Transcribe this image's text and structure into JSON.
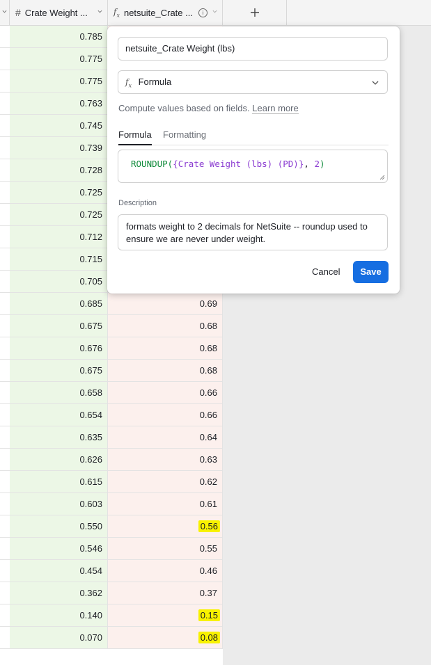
{
  "header": {
    "column1": {
      "label": "Crate Weight ...",
      "icon": "hash-icon"
    },
    "column2": {
      "label": "netsuite_Crate ...",
      "icon": "formula-icon"
    },
    "add_symbol": "+"
  },
  "rows": [
    {
      "crate_weight": "0.785",
      "netsuite": ""
    },
    {
      "crate_weight": "0.775",
      "netsuite": ""
    },
    {
      "crate_weight": "0.775",
      "netsuite": ""
    },
    {
      "crate_weight": "0.763",
      "netsuite": ""
    },
    {
      "crate_weight": "0.745",
      "netsuite": ""
    },
    {
      "crate_weight": "0.739",
      "netsuite": ""
    },
    {
      "crate_weight": "0.728",
      "netsuite": ""
    },
    {
      "crate_weight": "0.725",
      "netsuite": ""
    },
    {
      "crate_weight": "0.725",
      "netsuite": ""
    },
    {
      "crate_weight": "0.712",
      "netsuite": ""
    },
    {
      "crate_weight": "0.715",
      "netsuite": ""
    },
    {
      "crate_weight": "0.705",
      "netsuite": ""
    },
    {
      "crate_weight": "0.685",
      "netsuite": "0.69"
    },
    {
      "crate_weight": "0.675",
      "netsuite": "0.68"
    },
    {
      "crate_weight": "0.676",
      "netsuite": "0.68"
    },
    {
      "crate_weight": "0.675",
      "netsuite": "0.68"
    },
    {
      "crate_weight": "0.658",
      "netsuite": "0.66"
    },
    {
      "crate_weight": "0.654",
      "netsuite": "0.66"
    },
    {
      "crate_weight": "0.635",
      "netsuite": "0.64"
    },
    {
      "crate_weight": "0.626",
      "netsuite": "0.63"
    },
    {
      "crate_weight": "0.615",
      "netsuite": "0.62"
    },
    {
      "crate_weight": "0.603",
      "netsuite": "0.61"
    },
    {
      "crate_weight": "0.550",
      "netsuite": "0.56",
      "highlighted": true
    },
    {
      "crate_weight": "0.546",
      "netsuite": "0.55"
    },
    {
      "crate_weight": "0.454",
      "netsuite": "0.46"
    },
    {
      "crate_weight": "0.362",
      "netsuite": "0.37"
    },
    {
      "crate_weight": "0.140",
      "netsuite": "0.15",
      "highlighted": true
    },
    {
      "crate_weight": "0.070",
      "netsuite": "0.08",
      "highlighted": true
    }
  ],
  "field_editor": {
    "name_value": "netsuite_Crate Weight (lbs)",
    "type_label": "Formula",
    "helper_text": "Compute values based on fields.",
    "learn_more": "Learn more",
    "tabs": [
      "Formula",
      "Formatting"
    ],
    "formula": {
      "fn": "ROUNDUP(",
      "ref": "{Crate Weight (lbs) (PD)}",
      "sep": ", ",
      "num": "2",
      "close": ")"
    },
    "description_label": "Description",
    "description_value": "formats weight to 2 decimals for NetSuite -- roundup used to ensure we are never under weight.",
    "cancel_label": "Cancel",
    "save_label": "Save"
  },
  "colors": {
    "accent": "#166ee1",
    "column1_bg": "#ecf7e6",
    "column2_bg": "#fcf0ed",
    "highlight": "#f8f200"
  }
}
